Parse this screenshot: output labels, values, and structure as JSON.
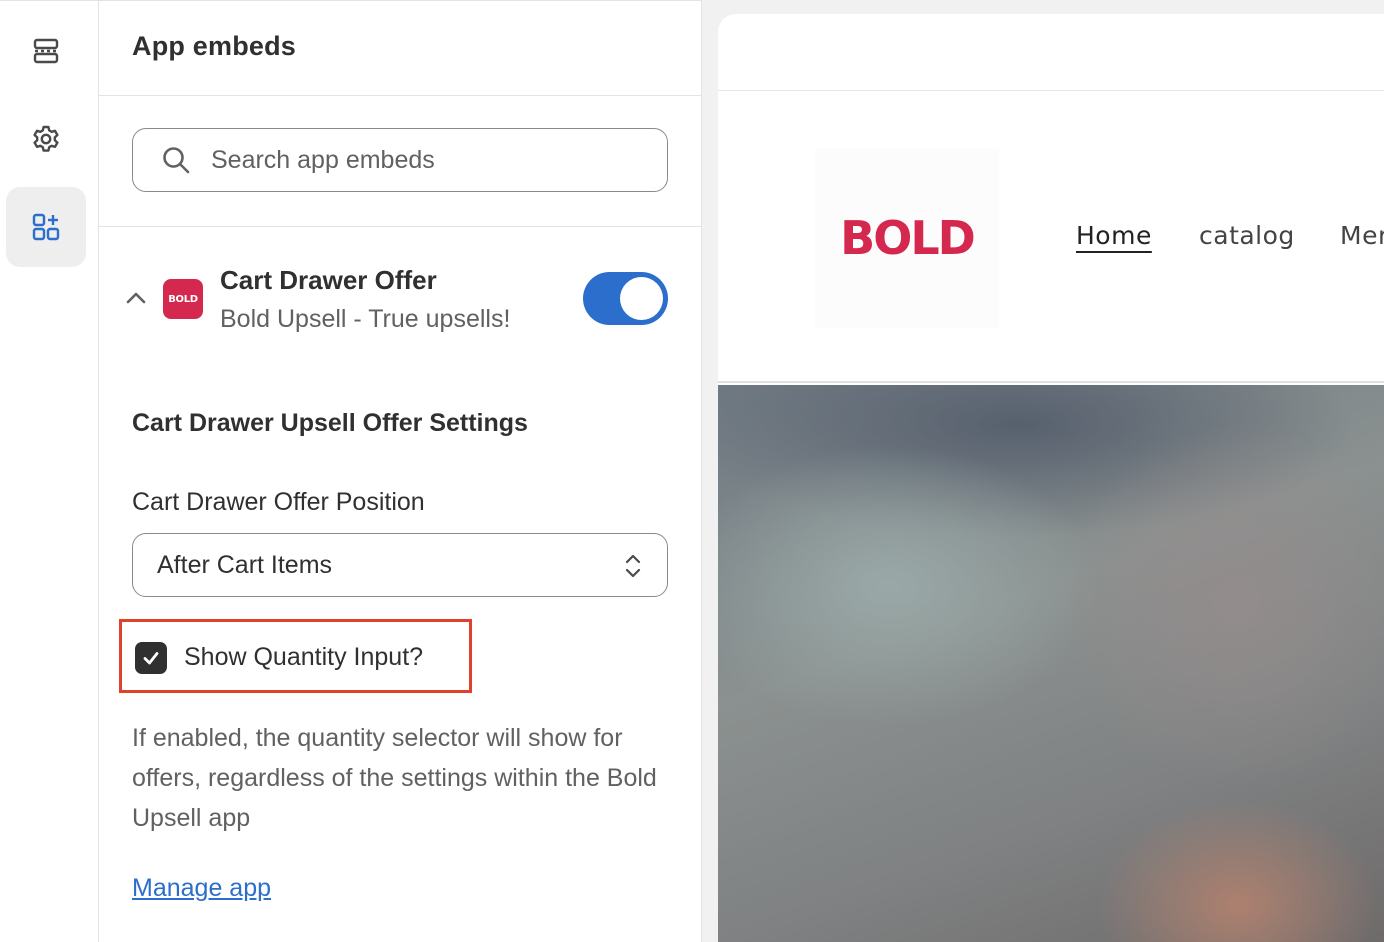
{
  "rail": {
    "items": [
      {
        "icon": "sections-icon",
        "active": false
      },
      {
        "icon": "gear-icon",
        "active": false
      },
      {
        "icon": "apps-icon",
        "active": true
      }
    ]
  },
  "panel": {
    "title": "App embeds",
    "search": {
      "placeholder": "Search app embeds",
      "value": ""
    },
    "embed": {
      "logo_text": "BOLD",
      "title": "Cart Drawer Offer",
      "subtitle": "Bold Upsell - True upsells!",
      "enabled": true
    },
    "settings": {
      "heading": "Cart Drawer Upsell Offer Settings",
      "position_label": "Cart Drawer Offer Position",
      "position_value": "After Cart Items",
      "checkbox_label": "Show Quantity Input?",
      "checkbox_checked": true,
      "help_text": "If enabled, the quantity selector will show for offers, regardless of the settings within the Bold Upsell app",
      "manage_link": "Manage app"
    }
  },
  "preview": {
    "logo_text": "BOLD",
    "nav": [
      "Home",
      "catalog",
      "Mer"
    ]
  },
  "colors": {
    "accent": "#2c6ecb",
    "brand": "#d4284e",
    "highlight": "#e1412b"
  }
}
